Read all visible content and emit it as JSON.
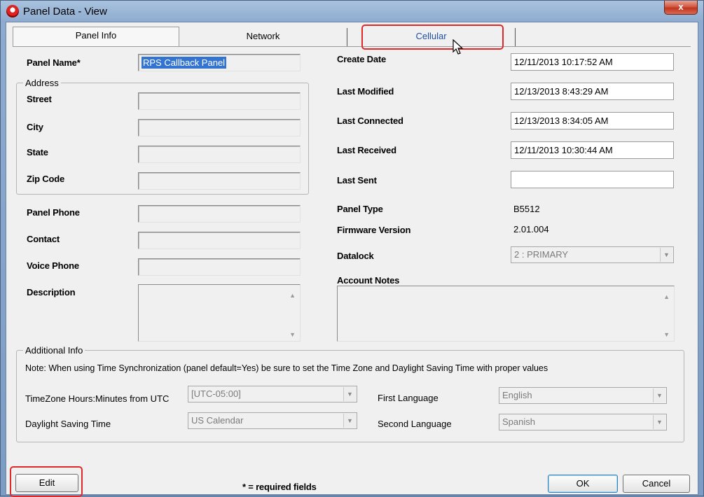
{
  "window": {
    "title": "Panel Data - View",
    "close_glyph": "x"
  },
  "tabs": [
    {
      "label": "Panel Info",
      "active": true
    },
    {
      "label": "Network",
      "active": false
    },
    {
      "label": "Cellular",
      "active": false,
      "highlighted": true
    }
  ],
  "left": {
    "panel_name_label": "Panel Name*",
    "panel_name_value": "RPS Callback Panel",
    "address_legend": "Address",
    "street_label": "Street",
    "street_value": "",
    "city_label": "City",
    "city_value": "",
    "state_label": "State",
    "state_value": "",
    "zip_label": "Zip Code",
    "zip_value": "",
    "panel_phone_label": "Panel Phone",
    "panel_phone_value": "",
    "contact_label": "Contact",
    "contact_value": "",
    "voice_phone_label": "Voice Phone",
    "voice_phone_value": "",
    "description_label": "Description",
    "description_value": ""
  },
  "right": {
    "create_date_label": "Create Date",
    "create_date_value": "12/11/2013 10:17:52 AM",
    "last_modified_label": "Last Modified",
    "last_modified_value": "12/13/2013 8:43:29 AM",
    "last_connected_label": "Last Connected",
    "last_connected_value": "12/13/2013 8:34:05 AM",
    "last_received_label": "Last Received",
    "last_received_value": "12/11/2013 10:30:44 AM",
    "last_sent_label": "Last Sent",
    "last_sent_value": "",
    "panel_type_label": "Panel Type",
    "panel_type_value": "B5512",
    "firmware_label": "Firmware Version",
    "firmware_value": "2.01.004",
    "datalock_label": "Datalock",
    "datalock_value": "2 : PRIMARY",
    "account_notes_label": "Account Notes",
    "account_notes_value": ""
  },
  "additional": {
    "legend": "Additional Info",
    "note": "Note: When using Time Synchronization (panel default=Yes) be sure to set the Time Zone and Daylight Saving Time with proper values",
    "timezone_label": "TimeZone Hours:Minutes  from UTC",
    "timezone_value": "[UTC-05:00]",
    "dst_label": "Daylight Saving Time",
    "dst_value": "US Calendar",
    "first_language_label": "First Language",
    "first_language_value": "English",
    "second_language_label": "Second Language",
    "second_language_value": "Spanish"
  },
  "footer": {
    "edit_label": "Edit",
    "required_note": "* = required fields",
    "ok_label": "OK",
    "cancel_label": "Cancel"
  },
  "colors": {
    "highlight": "#e02828",
    "selection": "#3374d0",
    "tab_link": "#1d4fa3"
  }
}
